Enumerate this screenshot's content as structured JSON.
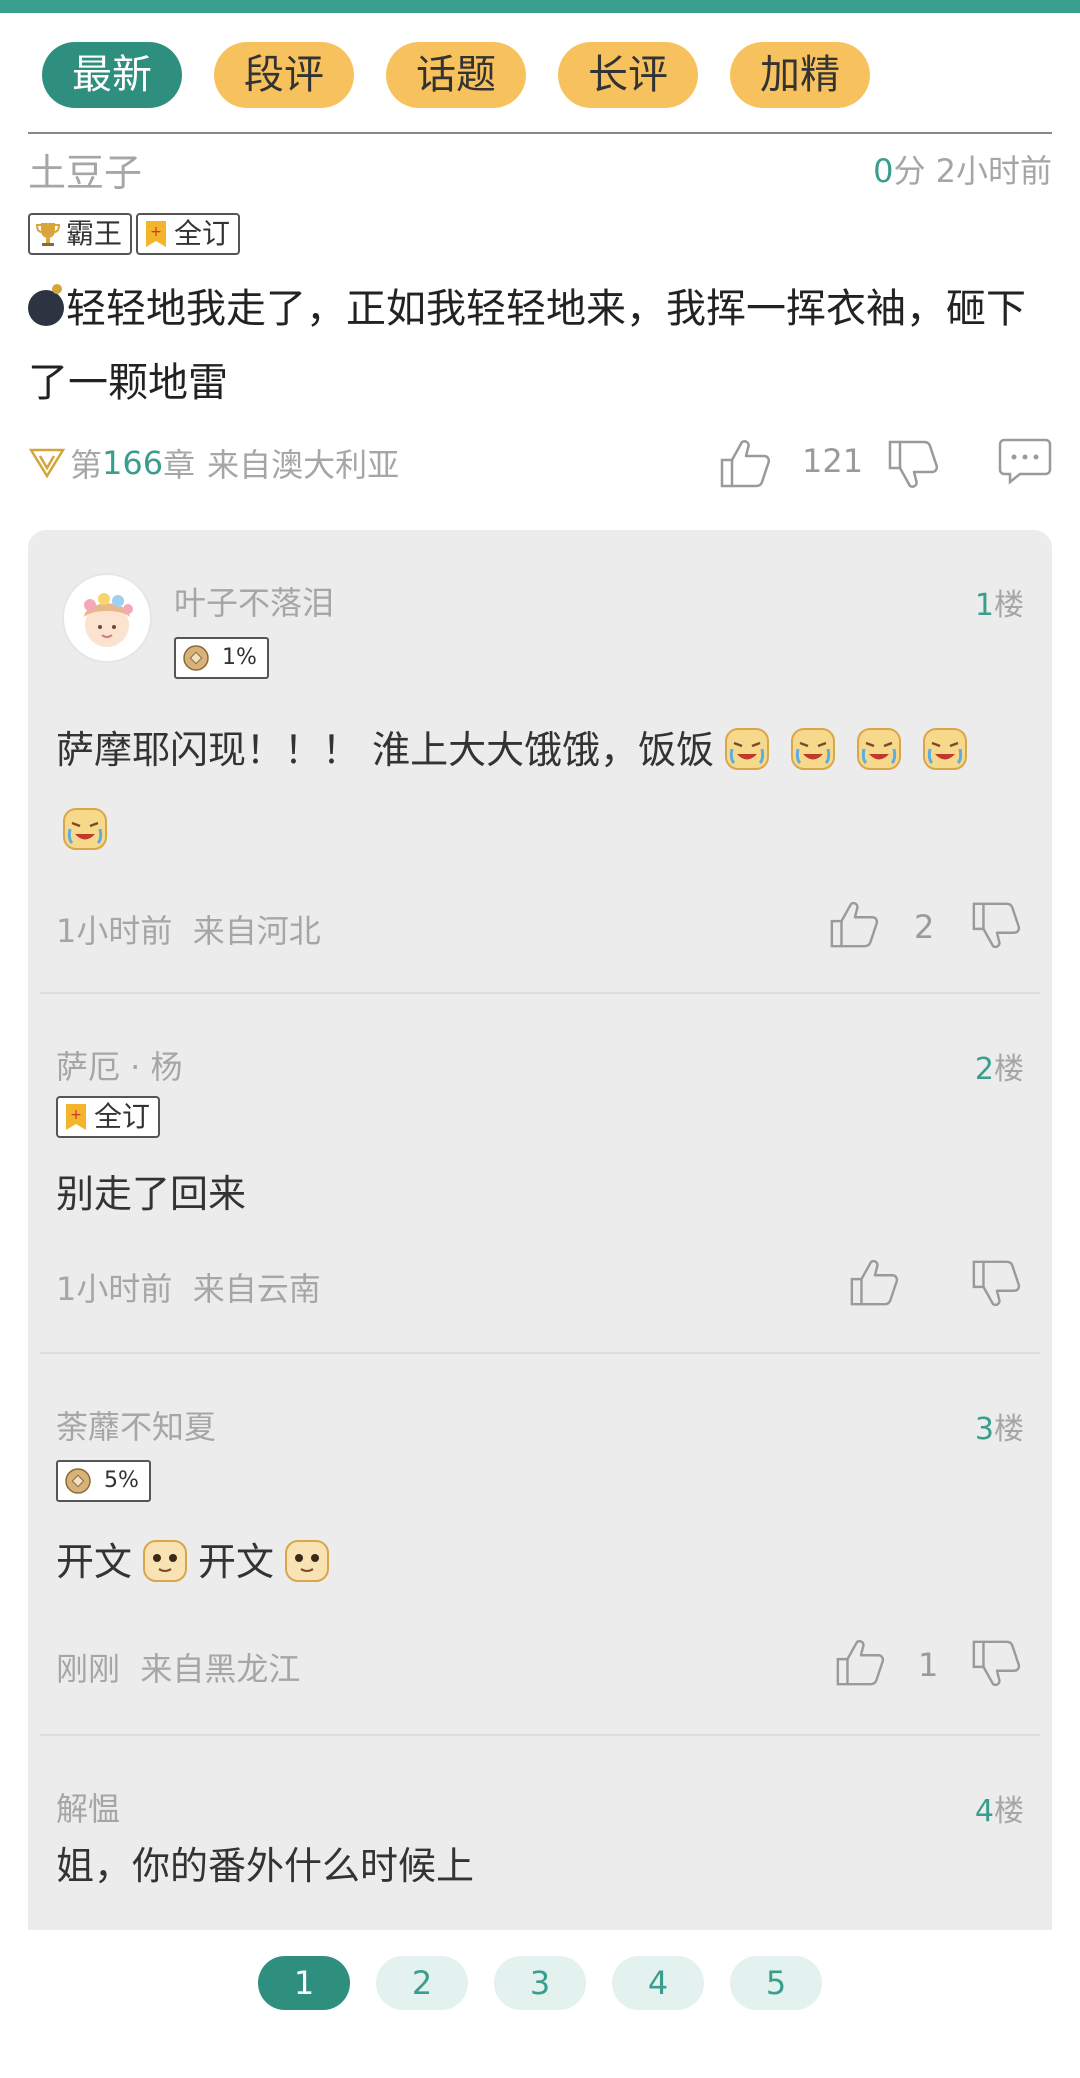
{
  "tabs": [
    {
      "label": "最新",
      "active": true
    },
    {
      "label": "段评",
      "active": false
    },
    {
      "label": "话题",
      "active": false
    },
    {
      "label": "长评",
      "active": false
    },
    {
      "label": "加精",
      "active": false
    }
  ],
  "post": {
    "author": "土豆子",
    "score": "0",
    "score_unit": "分",
    "time": "2小时前",
    "badges": [
      "霸王",
      "全订"
    ],
    "text": "轻轻地我走了，正如我轻轻地来，我挥一挥衣袖，砸下了一颗地雷",
    "chapter_prefix": "第",
    "chapter_num": "166",
    "chapter_suffix": "章",
    "location": "来自澳大利亚",
    "likes": "121"
  },
  "replies": [
    {
      "name": "叶子不落泪",
      "floor": "1",
      "floor_unit": "楼",
      "badge": "1%",
      "text": "萨摩耶闪现！！！ 淮上大大饿饿，饭饭",
      "time": "1小时前",
      "location": "来自河北",
      "likes": "2"
    },
    {
      "name": "萨厄 · 杨",
      "floor": "2",
      "floor_unit": "楼",
      "badge": "全订",
      "text": "别走了回来",
      "time": "1小时前",
      "location": "来自云南",
      "likes": ""
    },
    {
      "name": "荼蘼不知夏",
      "floor": "3",
      "floor_unit": "楼",
      "badge": "5%",
      "text_a": "开文",
      "text_b": "开文",
      "time": "刚刚",
      "location": "来自黑龙江",
      "likes": "1"
    },
    {
      "name": "解愠",
      "floor": "4",
      "floor_unit": "楼",
      "text": "姐，你的番外什么时候上"
    }
  ],
  "pages": [
    "1",
    "2",
    "3",
    "4",
    "5"
  ],
  "colors": {
    "accent": "#2e8f7f",
    "tab": "#f7c25e",
    "panel": "#ececec"
  }
}
